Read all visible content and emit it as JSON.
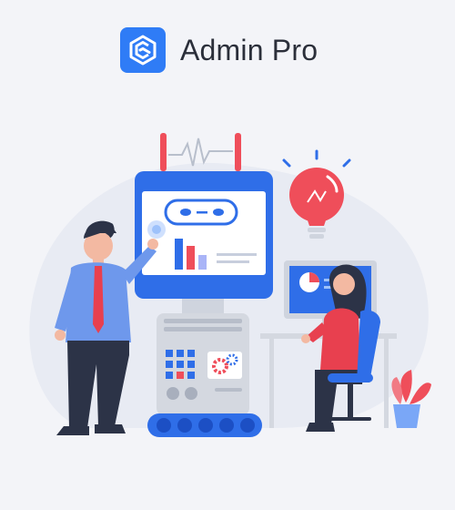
{
  "app": {
    "name": "Admin Pro",
    "logo_icon": "admin-pro-logo-icon"
  },
  "illustration": {
    "robot_icon": "robot-screen-icon",
    "bar_chart_icon": "bar-chart-icon",
    "pie_chart_icon": "pie-chart-icon",
    "lightbulb_icon": "lightbulb-icon",
    "gear_icon": "gear-icon",
    "plant_icon": "plant-icon"
  },
  "colors": {
    "brand_blue": "#2f7cf6",
    "accent_red": "#ef4e5a",
    "background": "#f3f4f8"
  }
}
